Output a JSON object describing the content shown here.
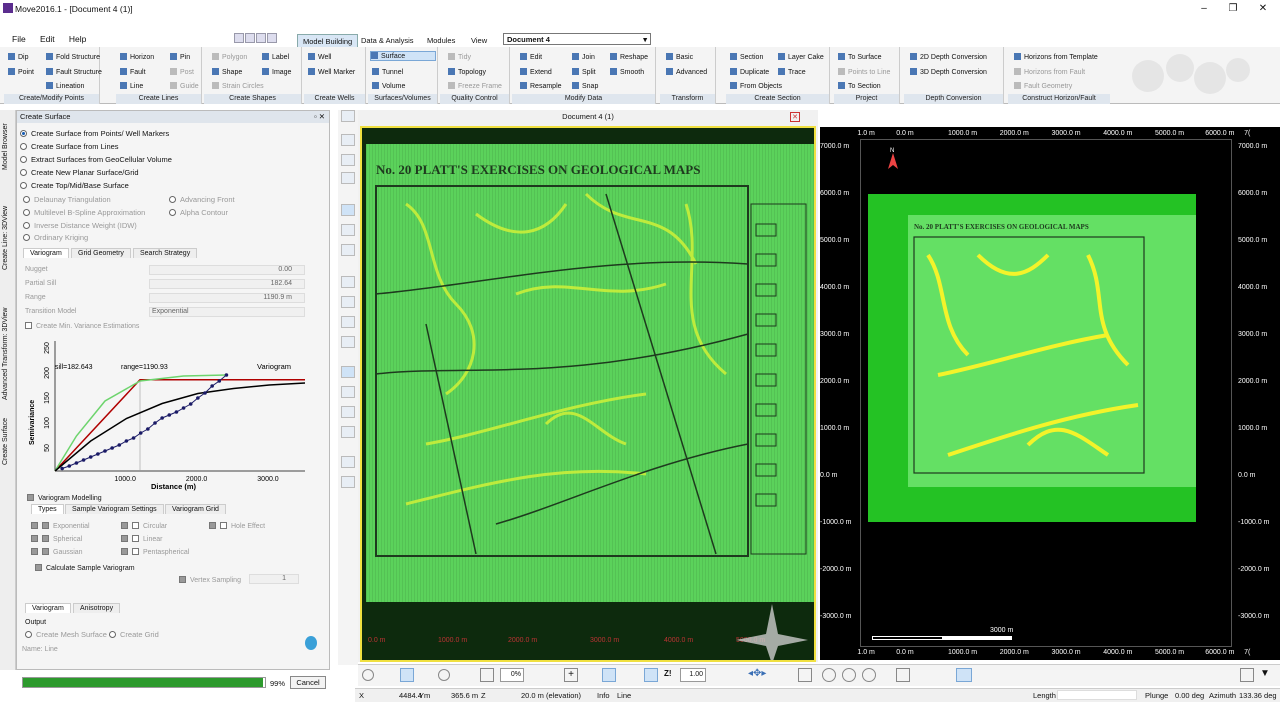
{
  "window": {
    "title": "Move2016.1 - [Document 4 (1)]"
  },
  "menu": [
    "File",
    "Edit",
    "Help"
  ],
  "top_tabs": [
    {
      "label": "Model Building",
      "active": true
    },
    {
      "label": "Data & Analysis"
    },
    {
      "label": "Modules"
    },
    {
      "label": "View"
    }
  ],
  "document_select": "Document 4",
  "ribbon": {
    "groups": [
      "Create/Modify Points",
      "Create Lines",
      "Create Shapes",
      "Create Wells",
      "Surfaces/Volumes",
      "Quality Control",
      "Modify Data",
      "Transform",
      "Create Section",
      "Project",
      "Depth Conversion",
      "Construct Horizon/Fault"
    ],
    "create_points": [
      "Dip",
      "Fold Structure",
      "Point",
      "Fault Structure",
      "Lineation"
    ],
    "create_lines": [
      "Horizon",
      "Pin",
      "Fault",
      "Post",
      "Line",
      "Guide"
    ],
    "create_shapes": [
      "Polygon",
      "Label",
      "Shape",
      "Image",
      "Strain Circles"
    ],
    "create_wells": [
      "Well",
      "Well Marker"
    ],
    "surfaces": [
      "Surface",
      "Tunnel",
      "Volume"
    ],
    "quality": [
      "Tidy",
      "Topology",
      "Freeze Frame"
    ],
    "modify": [
      "Edit",
      "Join",
      "Reshape",
      "Extend",
      "Split",
      "Smooth",
      "Resample",
      "Snap"
    ],
    "transform": [
      "Basic",
      "Advanced"
    ],
    "section": [
      "Section",
      "Layer Cake",
      "Duplicate",
      "Trace",
      "From Objects"
    ],
    "project": [
      "To Surface",
      "Points to Line",
      "To Section"
    ],
    "depth": [
      "2D Depth Conversion",
      "3D Depth Conversion"
    ],
    "horizon": [
      "Horizons from Template",
      "Horizons from Fault",
      "Fault Geometry"
    ]
  },
  "side_tabs": [
    "Model Browser",
    "Create Line: 3DView",
    "Advanced Transform: 3DView",
    "Create Surface"
  ],
  "panel": {
    "title": "Create Surface",
    "options": [
      "Create Surface from Points/ Well Markers",
      "Create Surface from Lines",
      "Extract Surfaces from GeoCellular Volume",
      "Create New Planar Surface/Grid",
      "Create Top/Mid/Base Surface"
    ],
    "methods_left": [
      "Delaunay Triangulation",
      "Multilevel B-Spline Approximation",
      "Inverse Distance Weight (IDW)",
      "Ordinary Kriging"
    ],
    "methods_right": [
      "Advancing Front",
      "Alpha Contour"
    ],
    "subtabs": [
      "Variogram",
      "Grid Geometry",
      "Search Strategy"
    ],
    "fields": [
      {
        "label": "Nugget",
        "value": "0.00"
      },
      {
        "label": "Partial Sill",
        "value": "182.64"
      },
      {
        "label": "Range",
        "value": "1190.9 m"
      },
      {
        "label": "Transition Model",
        "value": "Exponential"
      }
    ],
    "min_variance": "Create Min. Variance Estimations",
    "variogram_modelling": "Variogram Modelling",
    "vtabs": [
      "Types",
      "Sample Variogram Settings",
      "Variogram Grid"
    ],
    "types": [
      [
        "Exponential",
        "Circular",
        "Hole Effect"
      ],
      [
        "Spherical",
        "Linear"
      ],
      [
        "Gaussian",
        "Pentaspherical"
      ]
    ],
    "calc_sample": "Calculate Sample Variogram",
    "vertex_sampling": "Vertex Sampling",
    "vertex_value": "1",
    "bottom_tabs": [
      "Variogram",
      "Anisotropy"
    ],
    "output": "Output",
    "output_opts": [
      "Create Mesh Surface",
      "Create Grid"
    ],
    "name_label": "Name: Line"
  },
  "chart_data": {
    "type": "line",
    "title": "Variogram",
    "xlabel": "Distance (m)",
    "ylabel": "Semivariance",
    "xlim": [
      0,
      3500
    ],
    "ylim": [
      0,
      260
    ],
    "x_ticks": [
      "1000.0",
      "2000.0",
      "3000.0"
    ],
    "y_ticks": [
      "50",
      "100",
      "150",
      "200",
      "250"
    ],
    "annotations": [
      "sill=182.643",
      "range=1190.93"
    ],
    "series": [
      {
        "color": "#b00000",
        "x": [
          0,
          1190,
          3500
        ],
        "y": [
          0,
          182.6,
          182.6
        ]
      },
      {
        "color": "#6dd46d",
        "x": [
          0,
          300,
          700,
          1190,
          1800,
          2400
        ],
        "y": [
          0,
          70,
          140,
          180,
          190,
          192
        ]
      },
      {
        "color": "#000000",
        "x": [
          0,
          500,
          1000,
          1500,
          2000,
          2500,
          3000,
          3500
        ],
        "y": [
          0,
          60,
          105,
          135,
          155,
          165,
          172,
          176
        ]
      },
      {
        "color": "#1a1a66",
        "x": [
          100,
          200,
          300,
          400,
          500,
          600,
          700,
          800,
          900,
          1000,
          1100,
          1200,
          1300,
          1400,
          1500,
          1600,
          1700,
          1800,
          1900,
          2000,
          2100,
          2200,
          2300,
          2400
        ],
        "y": [
          5,
          10,
          16,
          22,
          28,
          34,
          40,
          46,
          52,
          60,
          66,
          76,
          84,
          96,
          106,
          112,
          118,
          126,
          134,
          146,
          156,
          170,
          180,
          192
        ]
      }
    ]
  },
  "progress": {
    "value": 0.99,
    "label": "99%",
    "cancel": "Cancel"
  },
  "doc": {
    "title": "Document 4 (1)",
    "map_caption": "No. 20  PLATT'S EXERCISES ON GEOLOGICAL MAPS",
    "x_ticks": [
      "0.0 m",
      "1000.0 m",
      "2000.0 m",
      "3000.0 m",
      "4000.0 m",
      "5000.0 m"
    ]
  },
  "right_view": {
    "x_ticks": [
      "1.0 m",
      "0.0 m",
      "1000.0 m",
      "2000.0 m",
      "3000.0 m",
      "4000.0 m",
      "5000.0 m",
      "6000.0 m",
      "7("
    ],
    "y_ticks": [
      "7000.0 m",
      "6000.0 m",
      "5000.0 m",
      "4000.0 m",
      "3000.0 m",
      "2000.0 m",
      "1000.0 m",
      "0.0 m",
      "-1000.0 m",
      "-2000.0 m",
      "-3000.0 m"
    ],
    "north": "N",
    "scale_label": "3000 m"
  },
  "bottom_tools": {
    "zoom_pct": "0%",
    "scale_value": "1.00",
    "z_label": "Z!"
  },
  "status": {
    "x_label": "X",
    "x": "4484.4 m",
    "y_label": "Y",
    "y": "365.6 m",
    "z_label": "Z",
    "z": "20.0 m (elevation)",
    "info_label": "Info",
    "info": "Line",
    "length_label": "Length",
    "plunge_label": "Plunge",
    "plunge": "0.00 deg",
    "azimuth_label": "Azimuth",
    "azimuth": "133.36 deg"
  }
}
